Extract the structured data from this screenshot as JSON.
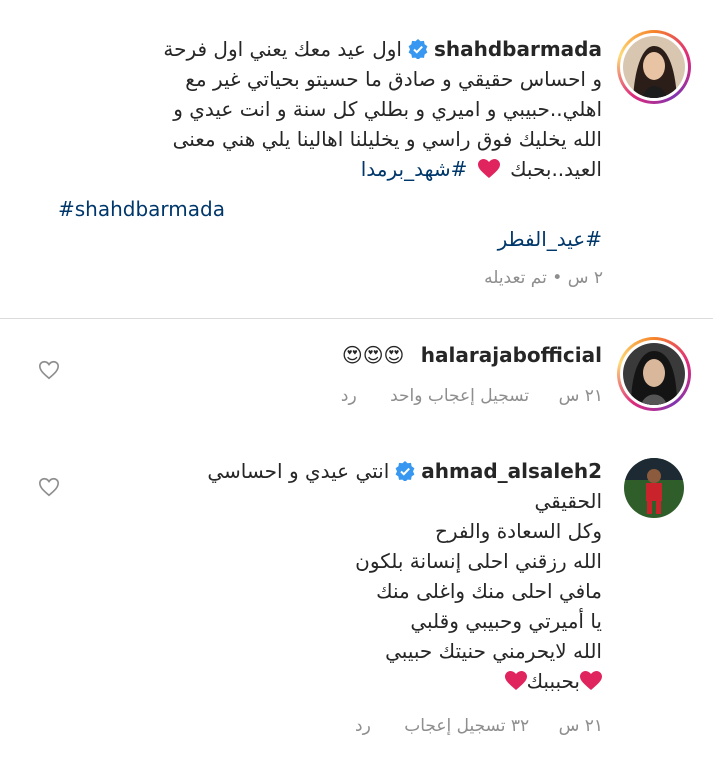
{
  "caption": {
    "username": "shahdbarmada",
    "lines": [
      "اول عيد معك يعني اول فرحة",
      "و احساس حقيقي و صادق ما حسيتو بحياتي غير مع",
      "اهلي..حبيبي و اميري و بطلي كل سنة و انت عيدي و",
      "الله يخليك فوق راسي و يخليلنا اهالينا يلي هني معنى",
      "العيد..بحبك"
    ],
    "hashtag_ar_1": "#شهد_برمدا",
    "hashtag_en": "#shahdbarmada",
    "hashtag_ar_2": "#عيد_الفطر",
    "meta": "٢ س • تم تعديله"
  },
  "comments": [
    {
      "username": "halarajabofficial",
      "text": "😍😍😍",
      "time": "٢١ س",
      "likes": "تسجيل إعجاب واحد",
      "reply": "رد"
    },
    {
      "username": "ahmad_alsaleh2",
      "lines": [
        "انتي عيدي و احساسي",
        "الحقيقي",
        "وكل السعادة والفرح",
        "الله رزقني احلى إنسانة بلكون",
        "مافي احلى منك واغلى منك",
        "يا أميرتي وحبيبي وقلبي",
        "الله لايحرمني حنيتك حبيبي",
        "بحبببك"
      ],
      "time": "٢١ س",
      "likes": "٣٢ تسجيل إعجاب",
      "reply": "رد"
    }
  ],
  "icons": {
    "verified": "verified-badge-icon",
    "like": "heart-outline-icon",
    "emoji_heart": "red-heart"
  },
  "colors": {
    "hashtag": "#00376b",
    "verified": "#3897f0",
    "meta": "#8e8e8e",
    "heart": "#ed4956"
  }
}
